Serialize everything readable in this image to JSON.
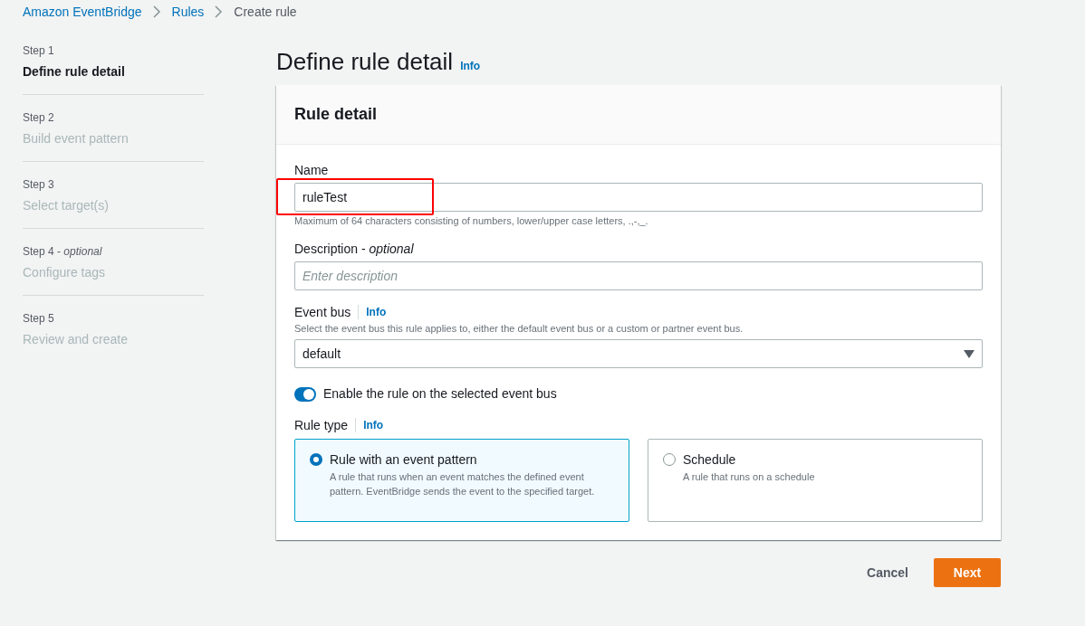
{
  "breadcrumbs": [
    {
      "label": "Amazon EventBridge",
      "kind": "link"
    },
    {
      "label": "Rules",
      "kind": "link"
    },
    {
      "label": "Create rule",
      "kind": "current"
    }
  ],
  "steps": [
    {
      "step": "Step 1",
      "title": "Define rule detail",
      "selected": true
    },
    {
      "step": "Step 2",
      "title": "Build event pattern",
      "selected": false
    },
    {
      "step": "Step 3",
      "title": "Select target(s)",
      "selected": false
    },
    {
      "step": "Step 4 - *optional*",
      "title": "Configure tags",
      "selected": false
    },
    {
      "step": "Step 5",
      "title": "Review and create",
      "selected": false
    }
  ],
  "page_title": "Define rule detail",
  "page_info": "Info",
  "card": {
    "title": "Rule detail",
    "name": {
      "label": "Name",
      "value": "ruleTest",
      "highlighted": true,
      "hint": "Maximum of 64 characters consisting of numbers, lower/upper case letters, .,-,_."
    },
    "description": {
      "label": "Description - *optional*",
      "placeholder": "Enter description"
    },
    "event_bus": {
      "label": "Event bus",
      "info": "Info",
      "hint": "Select the event bus this rule applies to, either the default event bus or a custom or partner event bus.",
      "value": "default"
    },
    "enable_toggle": {
      "label": "Enable the rule on the selected event bus",
      "on": true
    },
    "rule_type": {
      "label": "Rule type",
      "info": "Info",
      "options": [
        {
          "title": "Rule with an event pattern",
          "description": "A rule that runs when an event matches the defined event pattern. EventBridge sends the event to the specified target.",
          "selected": true
        },
        {
          "title": "Schedule",
          "description": "A rule that runs on a schedule",
          "selected": false
        }
      ]
    }
  },
  "buttons": {
    "cancel": "Cancel",
    "next": "Next"
  }
}
